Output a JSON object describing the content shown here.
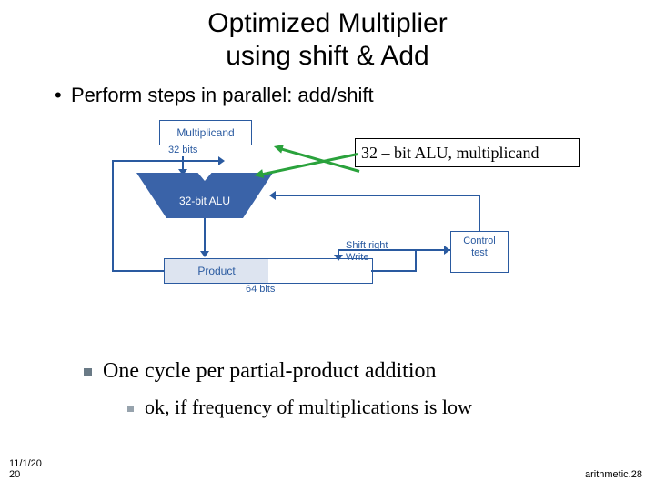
{
  "title_line1": "Optimized Multiplier",
  "title_line2": "using shift & Add",
  "bullet_main": "Perform steps in parallel: add/shift",
  "diagram": {
    "multiplicand_label": "Multiplicand",
    "multiplicand_bits": "32 bits",
    "alu_label": "32-bit ALU",
    "product_label": "Product",
    "product_bits": "64 bits",
    "shift_right_label": "Shift right",
    "write_label": "Write",
    "control_line1": "Control",
    "control_line2": "test"
  },
  "callout_text": "32 – bit ALU, multiplicand",
  "bullet_sub1": "One cycle per partial-product addition",
  "bullet_sub2": "ok, if frequency of multiplications is low",
  "footer": {
    "date_line1": "11/1/20",
    "date_line2": "20",
    "right": "arithmetic.",
    "page": "28"
  }
}
